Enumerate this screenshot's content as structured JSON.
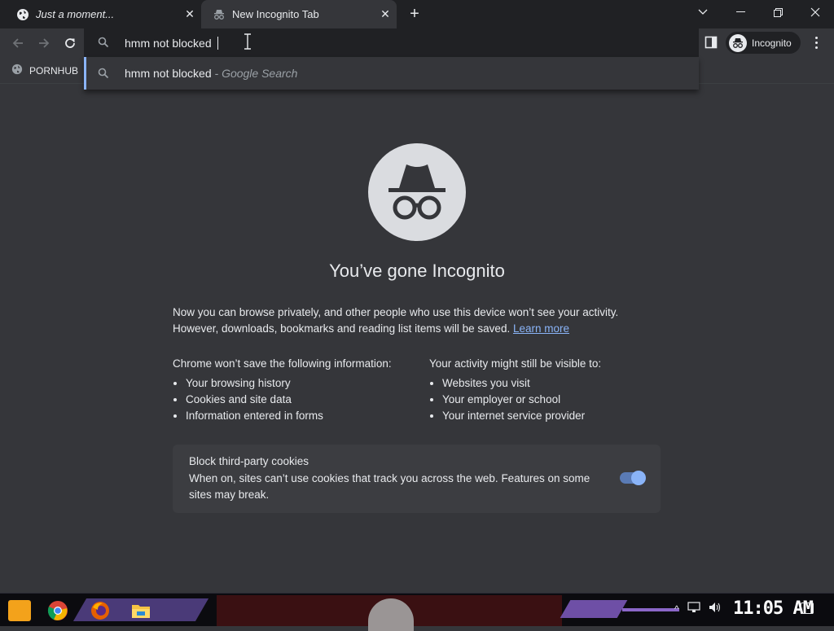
{
  "tabs": [
    {
      "title": "Just a moment..."
    },
    {
      "title": "New Incognito Tab"
    }
  ],
  "omnibox": {
    "value": "hmm not blocked",
    "suggestion": {
      "query": "hmm not blocked",
      "separator": " - ",
      "engine": "Google Search"
    }
  },
  "profile": {
    "label": "Incognito"
  },
  "bookmarks": [
    {
      "label": "PORNHUB"
    }
  ],
  "main": {
    "headline": "You’ve gone Incognito",
    "intro": "Now you can browse privately, and other people who use this device won’t see your activity. However, downloads, bookmarks and reading list items will be saved.",
    "learn_more": "Learn more",
    "left_heading": "Chrome won’t save the following information:",
    "left_items": [
      "Your browsing history",
      "Cookies and site data",
      "Information entered in forms"
    ],
    "right_heading": "Your activity might still be visible to:",
    "right_items": [
      "Websites you visit",
      "Your employer or school",
      "Your internet service provider"
    ],
    "cookies": {
      "title": "Block third-party cookies",
      "description": "When on, sites can’t use cookies that track you across the web. Features on some sites may break.",
      "enabled": true
    }
  },
  "taskbar": {
    "clock": "11:05 AM"
  },
  "colors": {
    "page_bg": "#35363a",
    "tabstrip_bg": "#202124",
    "accent": "#8ab4f8"
  }
}
